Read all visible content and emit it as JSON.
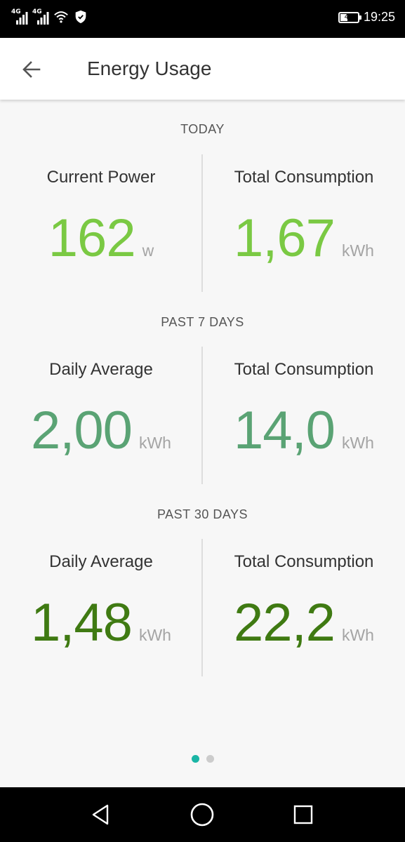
{
  "status_bar": {
    "network_1": "4G",
    "network_2": "4G",
    "battery_level": "47",
    "battery_fraction": 0.47,
    "time": "19:25",
    "icons": [
      "signal-icon",
      "signal-icon",
      "wifi-icon",
      "shield-icon",
      "battery-icon"
    ]
  },
  "header": {
    "title": "Energy Usage",
    "back_icon": "arrow-left-icon"
  },
  "sections": [
    {
      "title": "TODAY",
      "color": "#7ac943",
      "left": {
        "label": "Current Power",
        "value": "162",
        "unit": "w"
      },
      "right": {
        "label": "Total Consumption",
        "value": "1,67",
        "unit": "kWh"
      }
    },
    {
      "title": "PAST 7 DAYS",
      "color": "#5aa374",
      "left": {
        "label": "Daily Average",
        "value": "2,00",
        "unit": "kWh"
      },
      "right": {
        "label": "Total Consumption",
        "value": "14,0",
        "unit": "kWh"
      }
    },
    {
      "title": "PAST 30 DAYS",
      "color": "#3f7a12",
      "left": {
        "label": "Daily Average",
        "value": "1,48",
        "unit": "kWh"
      },
      "right": {
        "label": "Total Consumption",
        "value": "22,2",
        "unit": "kWh"
      }
    }
  ],
  "pager": {
    "pages": 2,
    "active": 0,
    "active_color": "#1ab5a5",
    "inactive_color": "#cccccc"
  },
  "nav_bar": {
    "icons": [
      "back-triangle-icon",
      "home-circle-icon",
      "recents-square-icon"
    ]
  }
}
